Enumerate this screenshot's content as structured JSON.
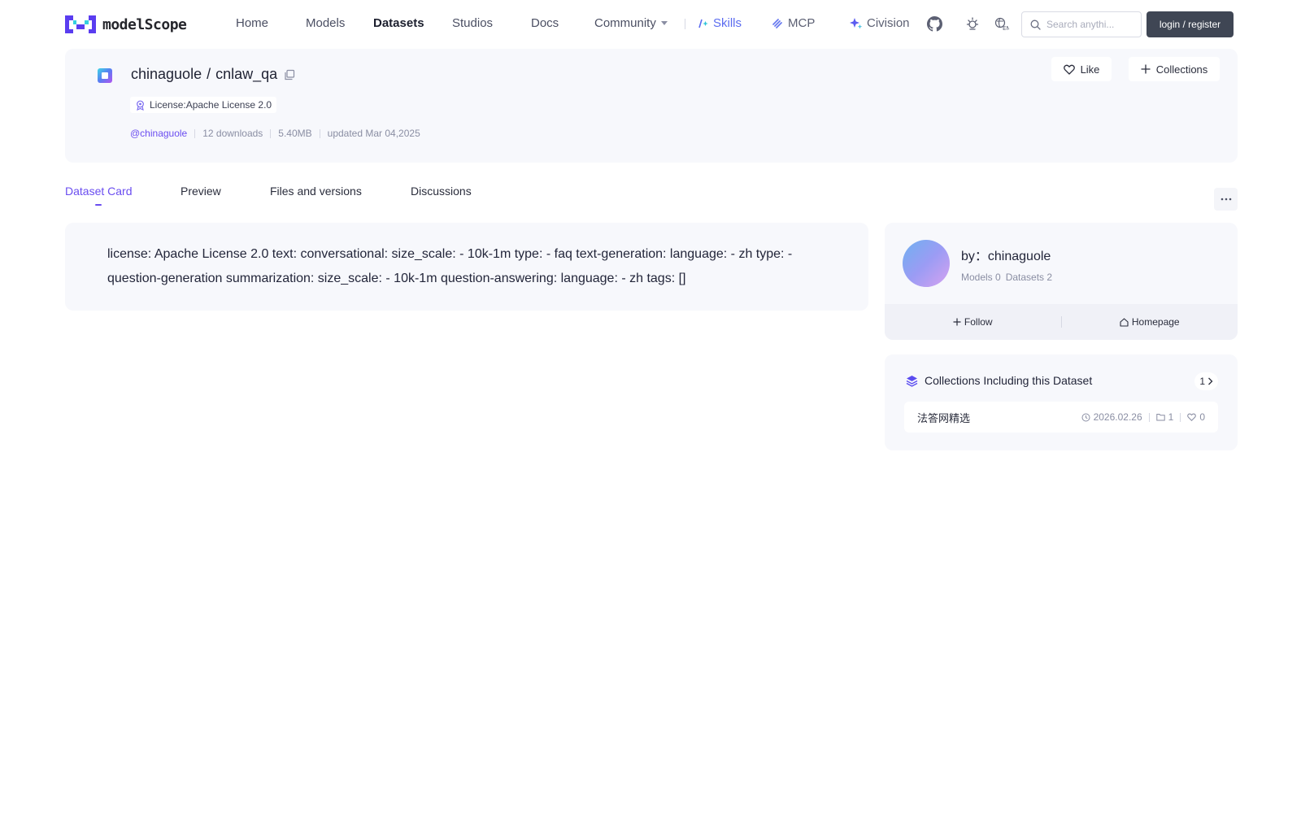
{
  "brand": {
    "name": "modelScope"
  },
  "nav": {
    "items": [
      {
        "label": "Home"
      },
      {
        "label": "Models"
      },
      {
        "label": "Datasets"
      },
      {
        "label": "Studios"
      },
      {
        "label": "Docs"
      },
      {
        "label": "Community"
      }
    ],
    "extras": [
      {
        "label": "Skills",
        "color": "#5b6cf0"
      },
      {
        "label": "MCP",
        "color": "#5c6073"
      },
      {
        "label": "Civision",
        "color": "#5c6073"
      }
    ],
    "search_placeholder": "Search anythi...",
    "login_label": "login / register"
  },
  "dataset": {
    "owner": "chinaguole",
    "slash": "/",
    "name": "cnlaw_qa",
    "license": "License:Apache License 2.0",
    "author_handle": "@chinaguole",
    "downloads": "12 downloads",
    "size": "5.40MB",
    "updated": "updated Mar 04,2025",
    "like_label": "Like",
    "collections_label": "Collections"
  },
  "tabs": [
    {
      "label": "Dataset Card"
    },
    {
      "label": "Preview"
    },
    {
      "label": "Files and versions"
    },
    {
      "label": "Discussions"
    }
  ],
  "readme": {
    "text": "license: Apache License 2.0 text: conversational: size_scale: - 10k-1m type: - faq text-generation: language: - zh type: - question-generation summarization: size_scale: - 10k-1m question-answering: language: - zh tags: []"
  },
  "author_card": {
    "by_label": "by：chinaguole",
    "models": "Models 0",
    "datasets": "Datasets 2",
    "follow_label": "Follow",
    "homepage_label": "Homepage"
  },
  "collections_card": {
    "title": "Collections Including this Dataset",
    "count": "1",
    "items": [
      {
        "name": "法答网精选",
        "date": "2026.02.26",
        "datasets": "1",
        "likes": "0"
      }
    ]
  },
  "colors": {
    "accent": "#6a4df0",
    "card_bg": "#f7f8fc",
    "login_bg": "#3f4654"
  }
}
